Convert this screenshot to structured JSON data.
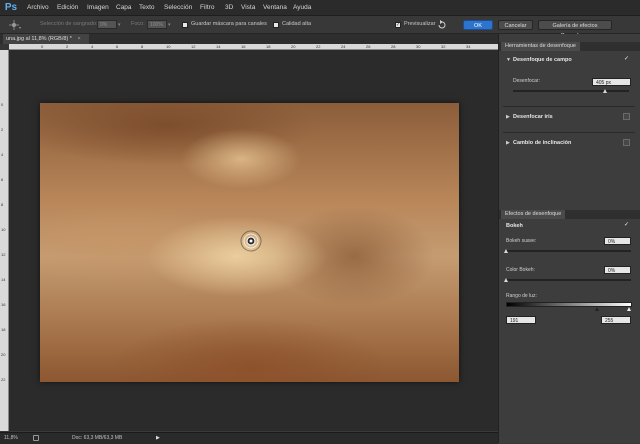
{
  "app": {
    "logo": "Ps"
  },
  "menu": [
    "Archivo",
    "Edición",
    "Imagen",
    "Capa",
    "Texto",
    "Selección",
    "Filtro",
    "3D",
    "Vista",
    "Ventana",
    "Ayuda"
  ],
  "options": {
    "seleccion_label": "Selección de sangrado:",
    "seleccion_value": "0%",
    "foco_label": "Foco:",
    "foco_value": "100%",
    "guardar_label": "Guardar máscara para canales",
    "calidad_label": "Calidad alta",
    "previsualizar_label": "Previsualizar",
    "previsualizar_checked": true,
    "ok_label": "OK",
    "cancel_label": "Cancelar",
    "gallery_label": "Galería de efectos Desenfocar"
  },
  "document": {
    "tab_label": "una.jpg al 11,8% (RGB/8) *",
    "close_glyph": "×"
  },
  "rulers": {
    "horizontal": [
      "0",
      "2",
      "4",
      "6",
      "8",
      "10",
      "12",
      "14",
      "16",
      "18",
      "20",
      "22",
      "24",
      "26",
      "28",
      "30",
      "32",
      "34"
    ],
    "vertical": [
      "0",
      "2",
      "4",
      "6",
      "8",
      "10",
      "12",
      "14",
      "16",
      "18",
      "20",
      "22"
    ]
  },
  "status": {
    "zoom": "11,8%",
    "doc": "Doc: 63,3 MB/63,3 MB",
    "arrow": "▶"
  },
  "blur_tools": {
    "tab_label": "Herramientas de desenfoque",
    "field_blur": {
      "title": "Desenfoque de campo",
      "enabled": true,
      "amount_label": "Desenfocar:",
      "amount_value": "405 px",
      "amount_fraction": 0.8
    },
    "iris_blur": {
      "title": "Desenfocar iris",
      "enabled": false
    },
    "tilt_shift": {
      "title": "Cambio de inclinación",
      "enabled": false
    }
  },
  "blur_effects": {
    "tab_label": "Efectos de desenfoque",
    "bokeh": {
      "title": "Bokeh",
      "enabled": true,
      "light_bokeh_label": "Bokeh suave:",
      "light_bokeh_value": "0%",
      "color_bokeh_label": "Color Bokeh:",
      "color_bokeh_value": "0%",
      "light_range_label": "Rango de luz:",
      "light_range_min": "191",
      "light_range_max": "255"
    }
  },
  "colors": {
    "accent": "#2d74cf",
    "panel_bg": "#3d3d3d",
    "workspace_bg": "#2b2b2b"
  },
  "icons": [
    "ps-logo-icon",
    "blur-tool-icon",
    "chevron-down-icon",
    "checkbox-icon",
    "reset-icon",
    "expand-triangle-icon",
    "pin-icon"
  ]
}
